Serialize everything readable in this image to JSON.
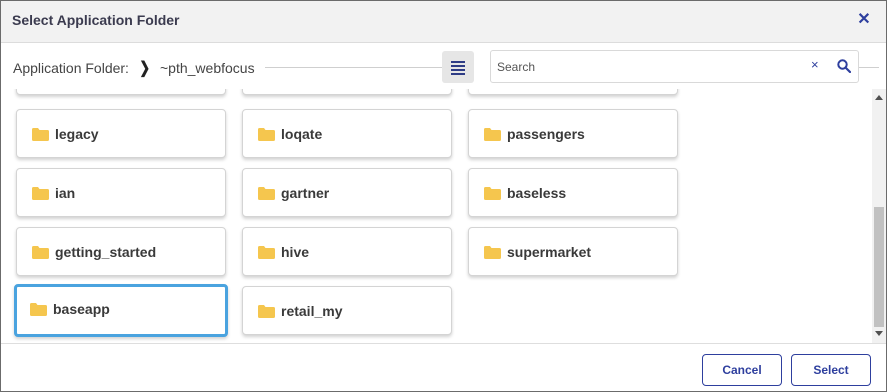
{
  "dialog": {
    "title": "Select Application Folder"
  },
  "path": {
    "label": "Application Folder:",
    "value": "~pth_webfocus"
  },
  "search": {
    "placeholder": "Search",
    "value": "",
    "clear_glyph": "×"
  },
  "colors": {
    "accent": "#2e3f9e",
    "selected_border": "#4aa3df",
    "folder": "#f5c64e"
  },
  "icons": {
    "close": "close-icon",
    "chevron": "chevron-right-icon",
    "list_view": "list-view-icon",
    "search": "search-icon",
    "folder": "folder-icon"
  },
  "folders": [
    {
      "name": ""
    },
    {
      "name": ""
    },
    {
      "name": ""
    },
    {
      "name": "legacy"
    },
    {
      "name": "loqate"
    },
    {
      "name": "passengers"
    },
    {
      "name": "ian"
    },
    {
      "name": "gartner"
    },
    {
      "name": "baseless"
    },
    {
      "name": "getting_started"
    },
    {
      "name": "hive"
    },
    {
      "name": "supermarket"
    },
    {
      "name": "baseapp",
      "selected": true
    },
    {
      "name": "retail_my"
    }
  ],
  "footer": {
    "cancel_label": "Cancel",
    "select_label": "Select"
  }
}
